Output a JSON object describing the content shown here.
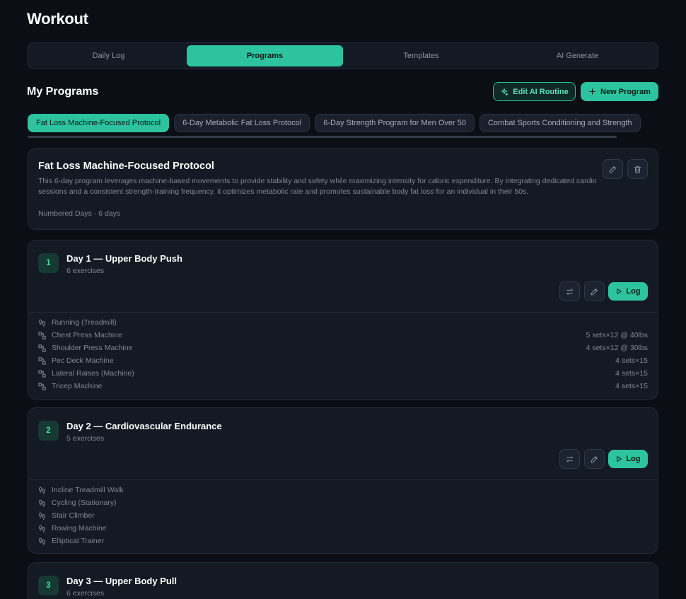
{
  "page": {
    "title": "Workout"
  },
  "tabs": [
    {
      "label": "Daily Log",
      "active": false
    },
    {
      "label": "Programs",
      "active": true
    },
    {
      "label": "Templates",
      "active": false
    },
    {
      "label": "AI Generate",
      "active": false
    }
  ],
  "programs_section": {
    "title": "My Programs",
    "edit_ai_label": "Edit AI Routine",
    "new_program_label": "New Program"
  },
  "program_chips": [
    {
      "label": "Fat Loss Machine-Focused Protocol",
      "active": true
    },
    {
      "label": "6-Day Metabolic Fat Loss Protocol",
      "active": false
    },
    {
      "label": "6-Day Strength Program for Men Over 50",
      "active": false
    },
    {
      "label": "Combat Sports Conditioning and Strength",
      "active": false
    }
  ],
  "program": {
    "name": "Fat Loss Machine-Focused Protocol",
    "description": "This 6-day program leverages machine-based movements to provide stability and safety while maximizing intensity for caloric expenditure. By integrating dedicated cardio sessions and a consistent strength-training frequency, it optimizes metabolic rate and promotes sustainable body fat loss for an individual in their 50s.",
    "meta": "Numbered Days · 6 days"
  },
  "days": [
    {
      "number": "1",
      "title": "Day 1 — Upper Body Push",
      "subtitle": "6 exercises",
      "log_label": "Log",
      "exercises": [
        {
          "name": "Running (Treadmill)",
          "detail": "",
          "icon": "footsteps-icon"
        },
        {
          "name": "Chest Press Machine",
          "detail": "5 sets×12 @ 40lbs",
          "icon": "machine-icon"
        },
        {
          "name": "Shoulder Press Machine",
          "detail": "4 sets×12 @ 30lbs",
          "icon": "machine-icon"
        },
        {
          "name": "Pec Deck Machine",
          "detail": "4 sets×15",
          "icon": "machine-icon"
        },
        {
          "name": "Lateral Raises (Machine)",
          "detail": "4 sets×15",
          "icon": "machine-icon"
        },
        {
          "name": "Tricep Machine",
          "detail": "4 sets×15",
          "icon": "machine-icon"
        }
      ]
    },
    {
      "number": "2",
      "title": "Day 2 — Cardiovascular Endurance",
      "subtitle": "5 exercises",
      "log_label": "Log",
      "exercises": [
        {
          "name": "Incline Treadmill Walk",
          "detail": "",
          "icon": "footsteps-icon"
        },
        {
          "name": "Cycling (Stationary)",
          "detail": "",
          "icon": "footsteps-icon"
        },
        {
          "name": "Stair Climber",
          "detail": "",
          "icon": "footsteps-icon"
        },
        {
          "name": "Rowing Machine",
          "detail": "",
          "icon": "footsteps-icon"
        },
        {
          "name": "Elliptical Trainer",
          "detail": "",
          "icon": "footsteps-icon"
        }
      ]
    },
    {
      "number": "3",
      "title": "Day 3 — Upper Body Pull",
      "subtitle": "6 exercises"
    }
  ],
  "colors": {
    "accent": "#2dc39e",
    "background": "#0b0e14",
    "card": "#141a24"
  }
}
